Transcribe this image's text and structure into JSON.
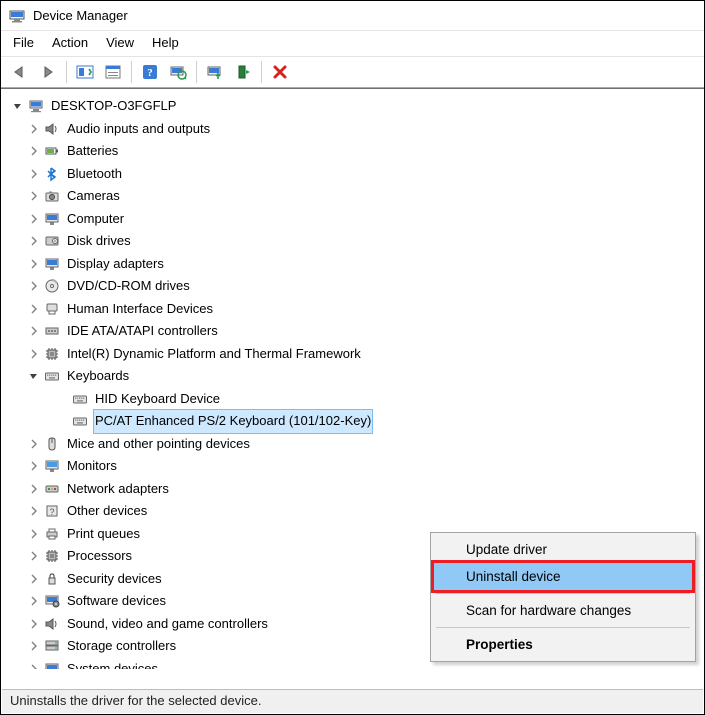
{
  "window": {
    "title": "Device Manager"
  },
  "menu": {
    "file": "File",
    "action": "Action",
    "view": "View",
    "help": "Help"
  },
  "toolbar": {
    "back": "back-icon",
    "forward": "forward-icon",
    "showhide": "showhide-icon",
    "help": "help-icon",
    "update": "update-icon",
    "uninstall": "uninstall-icon",
    "disable": "disable-icon",
    "remove_x": "remove-icon"
  },
  "tree": {
    "root": {
      "label": "DESKTOP-O3FGFLP",
      "expanded": true
    },
    "nodes": [
      {
        "label": "Audio inputs and outputs",
        "icon": "speaker",
        "expanded": false
      },
      {
        "label": "Batteries",
        "icon": "battery",
        "expanded": false
      },
      {
        "label": "Bluetooth",
        "icon": "bluetooth",
        "expanded": false
      },
      {
        "label": "Cameras",
        "icon": "camera",
        "expanded": false
      },
      {
        "label": "Computer",
        "icon": "monitor",
        "expanded": false
      },
      {
        "label": "Disk drives",
        "icon": "disk",
        "expanded": false
      },
      {
        "label": "Display adapters",
        "icon": "display",
        "expanded": false
      },
      {
        "label": "DVD/CD-ROM drives",
        "icon": "dvd",
        "expanded": false
      },
      {
        "label": "Human Interface Devices",
        "icon": "hid",
        "expanded": false
      },
      {
        "label": "IDE ATA/ATAPI controllers",
        "icon": "ide",
        "expanded": false
      },
      {
        "label": "Intel(R) Dynamic Platform and Thermal Framework",
        "icon": "chip",
        "expanded": false
      },
      {
        "label": "Keyboards",
        "icon": "keyboard",
        "expanded": true,
        "children": [
          {
            "label": "HID Keyboard Device",
            "icon": "keyboard",
            "selected": false
          },
          {
            "label": "PC/AT Enhanced PS/2 Keyboard (101/102-Key)",
            "icon": "keyboard",
            "selected": true
          }
        ]
      },
      {
        "label": "Mice and other pointing devices",
        "icon": "mouse",
        "expanded": false
      },
      {
        "label": "Monitors",
        "icon": "monitor2",
        "expanded": false
      },
      {
        "label": "Network adapters",
        "icon": "network",
        "expanded": false
      },
      {
        "label": "Other devices",
        "icon": "other",
        "expanded": false
      },
      {
        "label": "Print queues",
        "icon": "printer",
        "expanded": false
      },
      {
        "label": "Processors",
        "icon": "cpu",
        "expanded": false
      },
      {
        "label": "Security devices",
        "icon": "security",
        "expanded": false
      },
      {
        "label": "Software devices",
        "icon": "software",
        "expanded": false
      },
      {
        "label": "Sound, video and game controllers",
        "icon": "sound",
        "expanded": false
      },
      {
        "label": "Storage controllers",
        "icon": "storage",
        "expanded": false
      },
      {
        "label": "System devices",
        "icon": "system",
        "expanded": false
      }
    ]
  },
  "context_menu": {
    "update_driver": "Update driver",
    "uninstall_device": "Uninstall device",
    "scan": "Scan for hardware changes",
    "properties": "Properties"
  },
  "statusbar": {
    "text": "Uninstalls the driver for the selected device."
  }
}
